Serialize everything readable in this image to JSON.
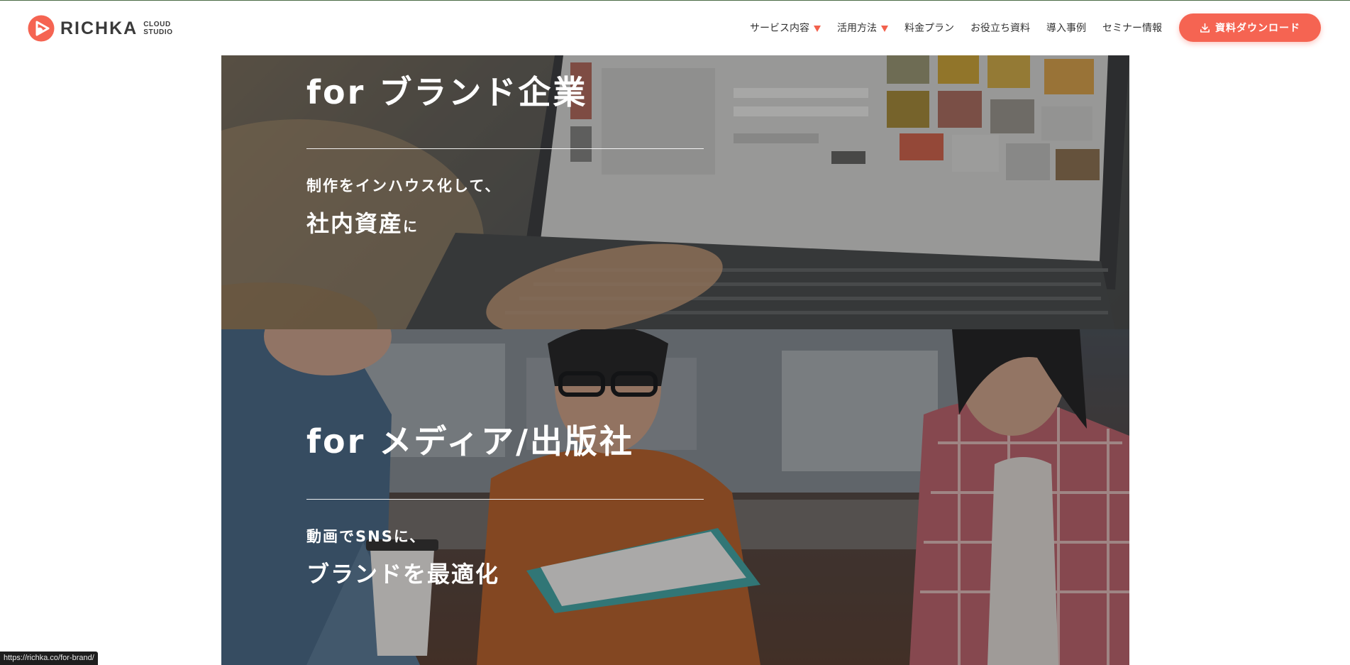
{
  "colors": {
    "brand_accent": "#f56452",
    "nav_text": "#333333",
    "logo_text": "#3a3a3a",
    "status_bar": "#1e1e1e"
  },
  "header": {
    "logo": {
      "wordmark": "RICHKA",
      "sub_line1": "CLOUD",
      "sub_line2": "STUDIO",
      "mark_icon": "play-triangle-circle-icon"
    },
    "nav": [
      {
        "label": "サービス内容",
        "dropdown": true
      },
      {
        "label": "活用方法",
        "dropdown": true
      },
      {
        "label": "料金プラン",
        "dropdown": false
      },
      {
        "label": "お役立ち資料",
        "dropdown": false
      },
      {
        "label": "導入事例",
        "dropdown": false
      },
      {
        "label": "セミナー情報",
        "dropdown": false
      }
    ],
    "cta": {
      "label": "資料ダウンロード",
      "icon": "download-icon"
    }
  },
  "sections": {
    "brand": {
      "heading": "for ブランド企業",
      "subline": "制作をインハウス化して、",
      "emphasis": "社内資産",
      "emphasis_tail": "に"
    },
    "media": {
      "heading": "for メディア/出版社",
      "subline": "動画でSNSに、",
      "emphasis": "ブランドを最適化",
      "emphasis_tail": ""
    }
  },
  "status_bar": {
    "url": "https://richka.co/for-brand/"
  }
}
